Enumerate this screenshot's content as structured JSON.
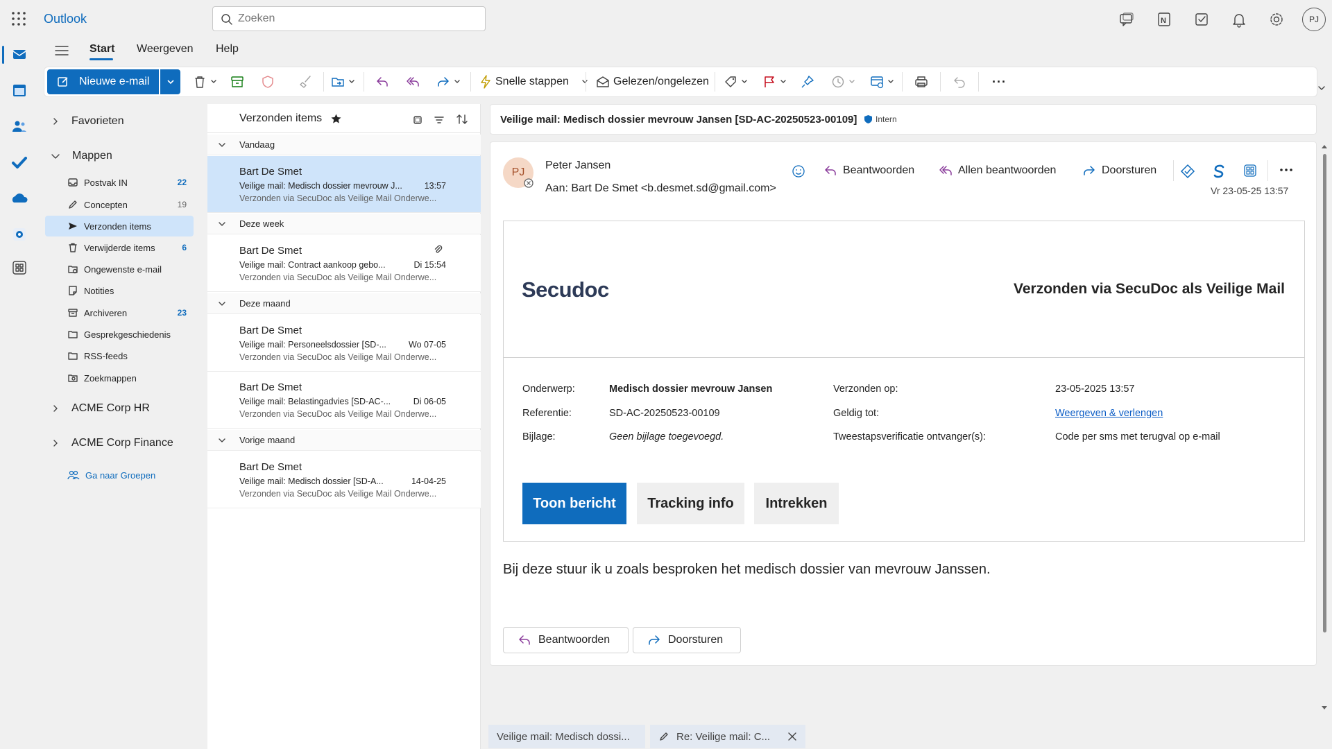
{
  "app": {
    "name": "Outlook",
    "avatar_initials": "PJ"
  },
  "search": {
    "placeholder": "Zoeken"
  },
  "tabs": [
    "Start",
    "Weergeven",
    "Help"
  ],
  "ribbon": {
    "new_mail": "Nieuwe e-mail",
    "quick_steps": "Snelle stappen",
    "read_unread": "Gelezen/ongelezen",
    "more": "···"
  },
  "folders": {
    "favorites": "Favorieten",
    "mappen": "Mappen",
    "items": [
      {
        "label": "Postvak IN",
        "count": "22"
      },
      {
        "label": "Concepten",
        "count": "19"
      },
      {
        "label": "Verzonden items",
        "count": ""
      },
      {
        "label": "Verwijderde items",
        "count": "6"
      },
      {
        "label": "Ongewenste e-mail",
        "count": ""
      },
      {
        "label": "Notities",
        "count": ""
      },
      {
        "label": "Archiveren",
        "count": "23"
      },
      {
        "label": "Gesprekgeschiedenis",
        "count": ""
      },
      {
        "label": "RSS-feeds",
        "count": ""
      },
      {
        "label": "Zoekmappen",
        "count": ""
      }
    ],
    "group_hr": "ACME Corp HR",
    "group_finance": "ACME Corp Finance",
    "go_groups": "Ga naar Groepen"
  },
  "message_list": {
    "title": "Verzonden items",
    "groups": [
      "Vandaag",
      "Deze week",
      "Deze maand",
      "Vorige maand"
    ],
    "messages": [
      {
        "from": "Bart De Smet",
        "subject": "Veilige mail: Medisch dossier mevrouw J...",
        "time": "13:57",
        "preview": "Verzonden via SecuDoc als Veilige Mail Onderwe..."
      },
      {
        "from": "Bart De Smet",
        "subject": "Veilige mail: Contract aankoop gebo...",
        "time": "Di 15:54",
        "preview": "Verzonden via SecuDoc als Veilige Mail Onderwe..."
      },
      {
        "from": "Bart De Smet",
        "subject": "Veilige mail: Personeelsdossier [SD-...",
        "time": "Wo 07-05",
        "preview": "Verzonden via SecuDoc als Veilige Mail Onderwe..."
      },
      {
        "from": "Bart De Smet",
        "subject": "Veilige mail: Belastingadvies [SD-AC-...",
        "time": "Di 06-05",
        "preview": "Verzonden via SecuDoc als Veilige Mail Onderwe..."
      },
      {
        "from": "Bart De Smet",
        "subject": "Veilige mail: Medisch dossier [SD-A...",
        "time": "14-04-25",
        "preview": "Verzonden via SecuDoc als Veilige Mail Onderwe..."
      }
    ]
  },
  "reading": {
    "subject": "Veilige mail: Medisch dossier mevrouw Jansen [SD-AC-20250523-00109]",
    "sensitivity": "Intern",
    "sender_initials": "PJ",
    "sender_name": "Peter Jansen",
    "to_line": "Aan:  Bart De Smet <b.desmet.sd@gmail.com>",
    "date": "Vr 23-05-25 13:57",
    "actions": {
      "reply": "Beantwoorden",
      "reply_all": "Allen beantwoorden",
      "forward": "Doorsturen"
    },
    "card": {
      "logo": "Secudoc",
      "title": "Verzonden via SecuDoc als Veilige Mail",
      "subject_label": "Onderwerp:",
      "subject_value": "Medisch dossier mevrouw Jansen",
      "ref_label": "Referentie:",
      "ref_value": "SD-AC-20250523-00109",
      "att_label": "Bijlage:",
      "att_value": "Geen bijlage toegevoegd.",
      "sent_label": "Verzonden op:",
      "sent_value": "23-05-2025 13:57",
      "valid_label": "Geldig tot:",
      "valid_value": "Weergeven & verlengen",
      "twofa_label": "Tweestapsverificatie ontvanger(s):",
      "twofa_value": "Code per sms met terugval op e-mail",
      "btn_show": "Toon bericht",
      "btn_tracking": "Tracking info",
      "btn_revoke": "Intrekken"
    },
    "body": "Bij deze stuur ik u zoals besproken het medisch dossier van mevrouw Janssen.",
    "footer_reply": "Beantwoorden",
    "footer_forward": "Doorsturen"
  },
  "bottom_tabs": [
    "Veilige mail: Medisch dossi...",
    "Re: Veilige mail: C..."
  ],
  "colors": {
    "accent": "#0f6cbd",
    "selected": "#cfe4fa"
  }
}
